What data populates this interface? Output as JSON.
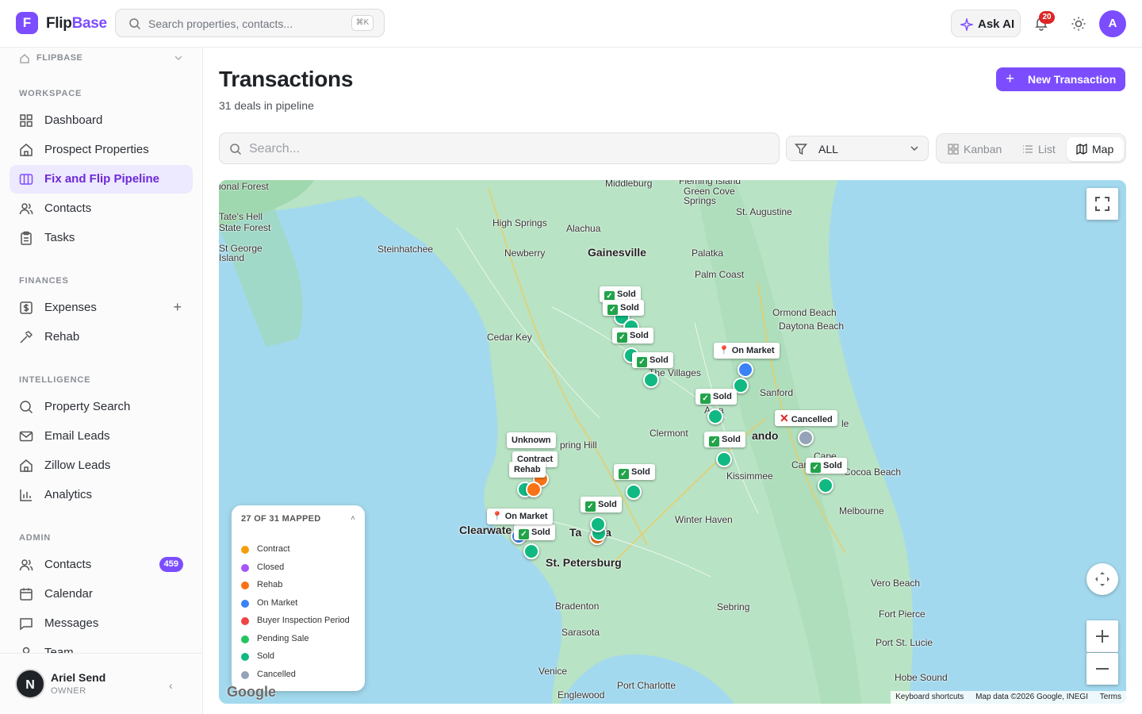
{
  "app": {
    "brand_part1": "Flip",
    "brand_part2": "Base",
    "logo_letter": "F"
  },
  "topbar": {
    "search_placeholder": "Search properties, contacts...",
    "search_shortcut": "⌘K",
    "ask_ai_label": "Ask AI",
    "notifications_count": "20",
    "avatar_letter": "A"
  },
  "sidebar": {
    "workspace_name": "FLIPBASE",
    "sections": {
      "workspace": "WORKSPACE",
      "finances": "FINANCES",
      "intelligence": "INTELLIGENCE",
      "admin": "ADMIN"
    },
    "items": {
      "dashboard": "Dashboard",
      "prospect": "Prospect Properties",
      "pipeline": "Fix and Flip Pipeline",
      "contacts": "Contacts",
      "tasks": "Tasks",
      "expenses": "Expenses",
      "rehab": "Rehab",
      "property_search": "Property Search",
      "email_leads": "Email Leads",
      "zillow_leads": "Zillow Leads",
      "analytics": "Analytics",
      "admin_contacts": "Contacts",
      "admin_contacts_count": "459",
      "calendar": "Calendar",
      "messages": "Messages",
      "team": "Team"
    },
    "user": {
      "initial": "N",
      "name": "Ariel Send",
      "role": "OWNER"
    }
  },
  "page": {
    "title": "Transactions",
    "subtitle": "31 deals in pipeline",
    "new_button": "New Transaction",
    "search_placeholder": "Search...",
    "filter_value": "ALL",
    "views": {
      "kanban": "Kanban",
      "list": "List",
      "map": "Map"
    },
    "active_view": "Map"
  },
  "map": {
    "places": {
      "gainesville": "Gainesville",
      "orlando": "ando",
      "tampa": "Ta",
      "tampa2": "a",
      "clearwater": "Clearwate",
      "st_pete": "St. Petersburg",
      "palatka": "Palatka",
      "st_augustine": "St. Augustine",
      "palm_coast": "Palm Coast",
      "ormond": "Ormond Beach",
      "daytona": "Daytona Beach",
      "sanford": "Sanford",
      "the_villages": "The Villages",
      "clermont": "Clermont",
      "kissimmee": "Kissimmee",
      "winter_haven": "Winter Haven",
      "cocoa": "Cocoa Beach",
      "melbourne": "Melbourne",
      "vero": "Vero Beach",
      "fort_pierce": "Fort Pierce",
      "port_st_lucie": "Port St. Lucie",
      "hobe": "Hobe Sound",
      "sebring": "Sebring",
      "bradenton": "Bradenton",
      "sarasota": "Sarasota",
      "venice": "Venice",
      "port_charlotte": "Port Charlotte",
      "englewood": "Englewood",
      "cedar_key": "Cedar Key",
      "steinhatchee": "Steinhatchee",
      "newberry": "Newberry",
      "alachua": "Alachua",
      "high_springs": "High Springs",
      "middleburg": "Middleburg",
      "green_cove": "Green Cove",
      "springs": "Springs",
      "fleming": "Fleming Island",
      "forest": "ional Forest",
      "tates1": "Tate's Hell",
      "tates2": "State Forest",
      "st_george1": "St George",
      "st_george2": "Island",
      "spring_hill": "pring Hill",
      "cape": "Cape",
      "cane": "Car",
      "le": "le",
      "apopka": "A",
      "apopka2": "a"
    },
    "pins": {
      "sold": "Sold",
      "on_market": "On Market",
      "cancelled": "Cancelled",
      "unknown": "Unknown",
      "contract": "Contract",
      "rehab": "Rehab"
    },
    "status_colors": {
      "contract": "#f59e0b",
      "closed": "#a855f7",
      "rehab": "#f97316",
      "on_market": "#3b82f6",
      "buyer_inspection": "#ef4444",
      "pending_sale": "#22c55e",
      "sold": "#10b981",
      "cancelled": "#94a3b8"
    },
    "legend": {
      "title": "27 OF 31 MAPPED",
      "items": [
        "Contract",
        "Closed",
        "Rehab",
        "On Market",
        "Buyer Inspection Period",
        "Pending Sale",
        "Sold",
        "Cancelled"
      ]
    },
    "google_logo": "Google",
    "attribution": {
      "shortcuts": "Keyboard shortcuts",
      "data": "Map data ©2026 Google, INEGI",
      "terms": "Terms"
    }
  }
}
